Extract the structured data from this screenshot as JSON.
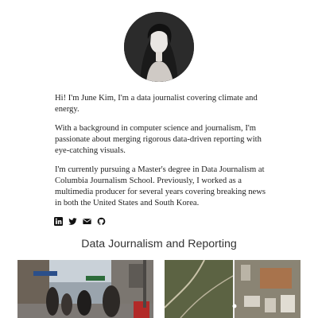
{
  "profile": {
    "avatar_alt": "June Kim portrait"
  },
  "bio": {
    "paragraphs": [
      "Hi! I'm June Kim, I'm a data journalist covering climate and energy.",
      "With a background in computer science and journalism, I'm passionate about merging rigorous data-driven reporting with eye-catching visuals.",
      "I'm currently pursuing a Master's degree in Data Journalism at Columbia Journalism School. Previously, I worked as a multimedia producer for several years covering breaking news in both the United States and South Korea."
    ]
  },
  "socials": [
    {
      "icon": "linkedin-icon"
    },
    {
      "icon": "twitter-icon"
    },
    {
      "icon": "email-icon"
    },
    {
      "icon": "github-icon"
    }
  ],
  "section": {
    "title": "Data Journalism and Reporting"
  },
  "projects": [
    {
      "image": "street-scene-photo"
    },
    {
      "image": "satellite-map-photo"
    }
  ],
  "colors": {
    "text": "#222222",
    "heading": "#333333",
    "avatar_bg": "#2a2a2a"
  }
}
